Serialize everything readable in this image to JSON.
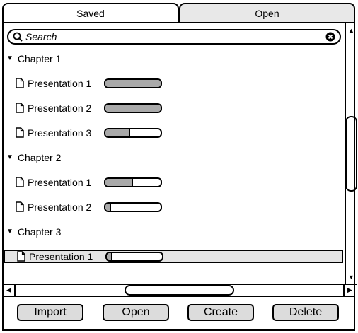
{
  "tabs": {
    "saved": "Saved",
    "open": "Open"
  },
  "search": {
    "placeholder": "Search"
  },
  "tree": {
    "chapters": [
      {
        "label": "Chapter 1",
        "items": [
          {
            "label": "Presentation 1",
            "progress": 1.0
          },
          {
            "label": "Presentation 2",
            "progress": 1.0
          },
          {
            "label": "Presentation 3",
            "progress": 0.45
          }
        ]
      },
      {
        "label": "Chapter 2",
        "items": [
          {
            "label": "Presentation 1",
            "progress": 0.5
          },
          {
            "label": "Presentation 2",
            "progress": 0.1
          }
        ]
      },
      {
        "label": "Chapter 3",
        "items": [
          {
            "label": "Presentation 1",
            "progress": 0.1,
            "selected": true
          }
        ]
      }
    ]
  },
  "buttons": {
    "import": "Import",
    "open": "Open",
    "create": "Create",
    "delete": "Delete"
  },
  "colors": {
    "progress_fill": "#a9a9a9",
    "selected_row": "#e4e4e4",
    "button_bg": "#dcdcdc"
  }
}
